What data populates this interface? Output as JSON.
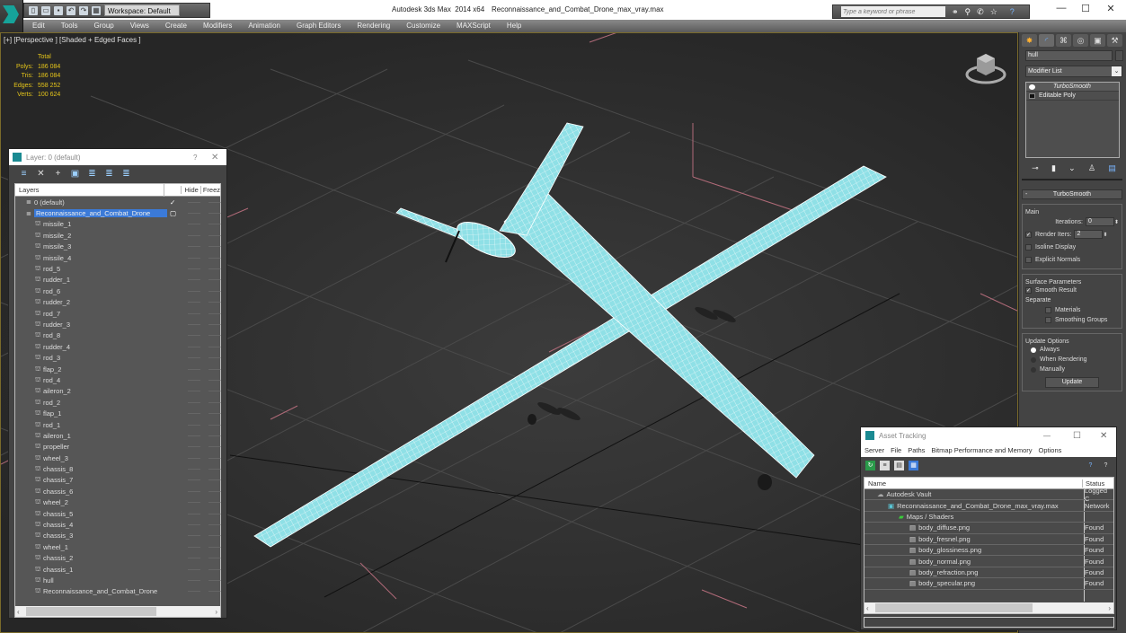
{
  "titlebar": {
    "app_title": "Autodesk 3ds Max  2014 x64",
    "file_name": "Reconnaissance_and_Combat_Drone_max_vray.max",
    "workspace": "Workspace: Default",
    "search_placeholder": "Type a keyword or phrase",
    "minimize": "—",
    "maximize": "☐",
    "close": "✕"
  },
  "menubar": [
    "Edit",
    "Tools",
    "Group",
    "Views",
    "Create",
    "Modifiers",
    "Animation",
    "Graph Editors",
    "Rendering",
    "Customize",
    "MAXScript",
    "Help"
  ],
  "viewport": {
    "label": "[+] [Perspective ] [Shaded + Edged Faces ]",
    "stats": {
      "header": "Total",
      "rows": [
        {
          "k": "Polys:",
          "v": "186 084"
        },
        {
          "k": "Tris:",
          "v": "186 084"
        },
        {
          "k": "Edges:",
          "v": "558 252"
        },
        {
          "k": "Verts:",
          "v": "100 624"
        }
      ]
    },
    "model_color": "#8fe0e6",
    "wire_color": "#ffffff"
  },
  "layer_window": {
    "title": "Layer: 0 (default)",
    "help": "?",
    "close": "✕",
    "columns": {
      "name": "Layers",
      "hide": "Hide",
      "freeze": "Freez"
    },
    "rows": [
      {
        "name": "0 (default)",
        "type": "layer",
        "check": "✓"
      },
      {
        "name": "Reconnaissance_and_Combat_Drone",
        "type": "layer",
        "selected": true
      },
      {
        "name": "missile_1"
      },
      {
        "name": "missile_2"
      },
      {
        "name": "missile_3"
      },
      {
        "name": "missile_4"
      },
      {
        "name": "rod_5"
      },
      {
        "name": "rudder_1"
      },
      {
        "name": "rod_6"
      },
      {
        "name": "rudder_2"
      },
      {
        "name": "rod_7"
      },
      {
        "name": "rudder_3"
      },
      {
        "name": "rod_8"
      },
      {
        "name": "rudder_4"
      },
      {
        "name": "rod_3"
      },
      {
        "name": "flap_2"
      },
      {
        "name": "rod_4"
      },
      {
        "name": "aileron_2"
      },
      {
        "name": "rod_2"
      },
      {
        "name": "flap_1"
      },
      {
        "name": "rod_1"
      },
      {
        "name": "aileron_1"
      },
      {
        "name": "propeller"
      },
      {
        "name": "wheel_3"
      },
      {
        "name": "chassis_8"
      },
      {
        "name": "chassis_7"
      },
      {
        "name": "chassis_6"
      },
      {
        "name": "wheel_2"
      },
      {
        "name": "chassis_5"
      },
      {
        "name": "chassis_4"
      },
      {
        "name": "chassis_3"
      },
      {
        "name": "wheel_1"
      },
      {
        "name": "chassis_2"
      },
      {
        "name": "chassis_1"
      },
      {
        "name": "hull"
      },
      {
        "name": "Reconnaissance_and_Combat_Drone"
      }
    ]
  },
  "command_panel": {
    "object_name": "hull",
    "modifier_list": "Modifier List",
    "stack": [
      "TurboSmooth",
      "Editable Poly"
    ],
    "rollout_title": "TurboSmooth",
    "main_group": "Main",
    "iterations_label": "Iterations:",
    "iterations_value": "0",
    "render_iters_label": "Render Iters:",
    "render_iters_value": "2",
    "render_iters_checked": true,
    "isoline_label": "Isoline Display",
    "explicit_normals_label": "Explicit Normals",
    "surface_group": "Surface Parameters",
    "smooth_result_label": "Smooth Result",
    "smooth_result_checked": true,
    "separate_label": "Separate",
    "materials_label": "Materials",
    "smoothing_groups_label": "Smoothing Groups",
    "update_group": "Update Options",
    "update_options": [
      {
        "label": "Always",
        "selected": true
      },
      {
        "label": "When Rendering",
        "selected": false
      },
      {
        "label": "Manually",
        "selected": false
      }
    ],
    "update_button": "Update"
  },
  "asset_tracking": {
    "title": "Asset Tracking",
    "menu": [
      "Server",
      "File",
      "Paths",
      "Bitmap Performance and Memory",
      "Options"
    ],
    "columns": {
      "name": "Name",
      "status": "Status"
    },
    "rows": [
      {
        "name": "Autodesk Vault",
        "status": "Logged C",
        "indent": 0
      },
      {
        "name": "Reconnaissance_and_Combat_Drone_max_vray.max",
        "status": "Network",
        "indent": 1
      },
      {
        "name": "Maps / Shaders",
        "status": "",
        "indent": 2
      },
      {
        "name": "body_diffuse.png",
        "status": "Found",
        "indent": 3
      },
      {
        "name": "body_fresnel.png",
        "status": "Found",
        "indent": 3
      },
      {
        "name": "body_glossiness.png",
        "status": "Found",
        "indent": 3
      },
      {
        "name": "body_normal.png",
        "status": "Found",
        "indent": 3
      },
      {
        "name": "body_refraction.png",
        "status": "Found",
        "indent": 3
      },
      {
        "name": "body_specular.png",
        "status": "Found",
        "indent": 3
      }
    ]
  }
}
